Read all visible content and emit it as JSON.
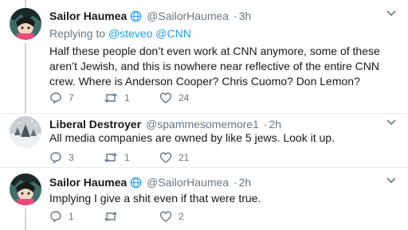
{
  "tweets": [
    {
      "name": "Sailor Haumea",
      "handle": "@SailorHaumea",
      "dot": "·",
      "time": "3h",
      "reply_prefix": "Replying to",
      "reply_to_1": "@steveo",
      "reply_to_2": "@CNN",
      "text": "Half these people don’t even work at CNN anymore, some of these aren’t Jewish, and this is nowhere near reflective of the entire CNN crew. Where is Anderson Cooper? Chris Cuomo? Don Lemon?",
      "replies": "7",
      "retweets": "1",
      "likes": "24"
    },
    {
      "name": "Liberal Destroyer",
      "handle": "@spammesomemore1",
      "dot": "·",
      "time": "2h",
      "text": "All media companies are owned by like 5 jews. Look it up.",
      "replies": "3",
      "retweets": "1",
      "likes": "21"
    },
    {
      "name": "Sailor Haumea",
      "handle": "@SailorHaumea",
      "dot": "·",
      "time": "2h",
      "text": "Implying I give a shit even if that were true.",
      "replies": "1",
      "retweets": "",
      "likes": "2"
    }
  ],
  "colors": {
    "text": "#14171a",
    "muted": "#657786",
    "link": "#1da1f2",
    "verified_badge_outline": "#1da1f2",
    "divider": "#e6ecf0"
  },
  "icons": [
    "verified-globe-icon",
    "chevron-down-icon",
    "reply-icon",
    "retweet-icon",
    "like-heart-icon"
  ]
}
